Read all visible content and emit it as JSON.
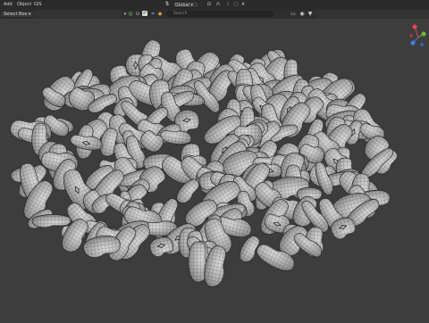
{
  "header": {
    "menu": [
      "Add",
      "Object",
      "GIS"
    ],
    "orientation": "Global",
    "select_mode": "Select Box"
  },
  "outliner": {
    "search_placeholder": "Search"
  },
  "icons": {
    "transform_orientation": "orientation-icon",
    "pivot": "pivot-icon",
    "snap": "magnet-icon",
    "proportional": "proportional-edit-icon",
    "filter": "filter-icon",
    "view_layer": "view-layer-icon"
  },
  "gizmo": {
    "x_color": "#e04848",
    "y_color": "#6fb43a",
    "z_color": "#4a79e0"
  },
  "viewport": {
    "background": "#3d3d3d",
    "object": "beans-pile-wireframe"
  }
}
